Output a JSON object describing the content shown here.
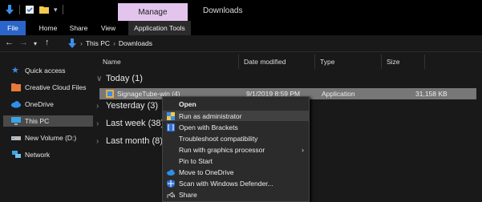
{
  "window": {
    "title": "Downloads",
    "manage_label": "Manage"
  },
  "ribbon": {
    "tabs": [
      {
        "label": "File"
      },
      {
        "label": "Home"
      },
      {
        "label": "Share"
      },
      {
        "label": "View"
      },
      {
        "label": "Application Tools"
      }
    ]
  },
  "address": {
    "crumbs": [
      "This PC",
      "Downloads"
    ]
  },
  "sidebar": {
    "items": [
      {
        "label": "Quick access",
        "icon": "star-icon"
      },
      {
        "label": "Creative Cloud Files",
        "icon": "folder-icon"
      },
      {
        "label": "OneDrive",
        "icon": "cloud-icon"
      },
      {
        "label": "This PC",
        "icon": "pc-icon"
      },
      {
        "label": "New Volume (D:)",
        "icon": "drive-icon"
      },
      {
        "label": "Network",
        "icon": "network-icon"
      }
    ]
  },
  "columns": {
    "name": "Name",
    "date": "Date modified",
    "type": "Type",
    "size": "Size"
  },
  "groups": {
    "today": "Today (1)",
    "yesterday": "Yesterday (3)",
    "last_week": "Last week (38)",
    "last_month": "Last month (8)"
  },
  "file": {
    "name": "SignageTube-win (4)",
    "date": "9/1/2019 8:59 PM",
    "type": "Application",
    "size": "31,158 KB"
  },
  "context_menu": {
    "items": [
      {
        "label": "Open"
      },
      {
        "label": "Run as administrator"
      },
      {
        "label": "Open with Brackets"
      },
      {
        "label": "Troubleshoot compatibility"
      },
      {
        "label": "Run with graphics processor"
      },
      {
        "label": "Pin to Start"
      },
      {
        "label": "Move to OneDrive"
      },
      {
        "label": "Scan with Windows Defender..."
      },
      {
        "label": "Share"
      }
    ]
  },
  "colors": {
    "accent": "#2a65c9",
    "manage_bg": "#e3c4ec",
    "selection": "#777777",
    "menu_highlight": "#414141"
  }
}
